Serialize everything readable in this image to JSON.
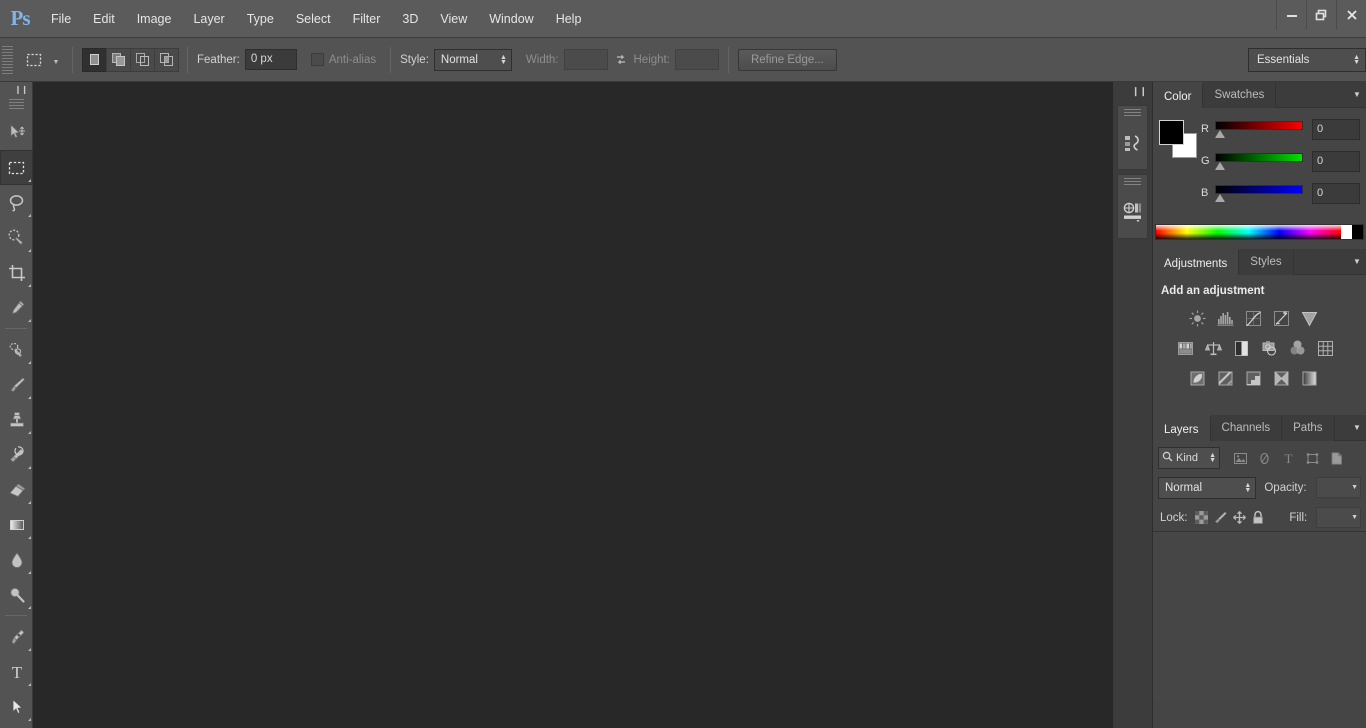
{
  "app": {
    "logo": "Ps",
    "accent_color": "#7fb5e8",
    "menubar_bg": "#5b5b5b",
    "canvas_bg": "#282828",
    "panel_bg": "#454545"
  },
  "menu": {
    "items": [
      {
        "label": "File"
      },
      {
        "label": "Edit"
      },
      {
        "label": "Image"
      },
      {
        "label": "Layer"
      },
      {
        "label": "Type"
      },
      {
        "label": "Select"
      },
      {
        "label": "Filter"
      },
      {
        "label": "3D"
      },
      {
        "label": "View"
      },
      {
        "label": "Window"
      },
      {
        "label": "Help"
      }
    ]
  },
  "window_controls": {
    "minimize": "minimize-icon",
    "restore": "restore-icon",
    "close": "close-icon"
  },
  "options_bar": {
    "tool_icon": "rectangular-marquee-icon",
    "selection_modes": [
      {
        "name": "new-selection",
        "active": true
      },
      {
        "name": "add-to-selection",
        "active": false
      },
      {
        "name": "subtract-from-selection",
        "active": false
      },
      {
        "name": "intersect-with-selection",
        "active": false
      }
    ],
    "feather_label": "Feather:",
    "feather_value": "0 px",
    "antialias_label": "Anti-alias",
    "antialias_checked": false,
    "style_label": "Style:",
    "style_value": "Normal",
    "width_label": "Width:",
    "width_value": "",
    "swap_icon": "swap-width-height-icon",
    "height_label": "Height:",
    "height_value": "",
    "refine_edge_label": "Refine Edge...",
    "workspace": "Essentials"
  },
  "toolbar": {
    "collapse_icon": "collapse-panel-icon",
    "tools": [
      {
        "name": "move-tool",
        "active": false,
        "has_flyout": false
      },
      {
        "name": "rectangular-marquee-tool",
        "active": true,
        "has_flyout": true
      },
      {
        "name": "lasso-tool",
        "active": false,
        "has_flyout": true
      },
      {
        "name": "quick-selection-tool",
        "active": false,
        "has_flyout": true
      },
      {
        "name": "crop-tool",
        "active": false,
        "has_flyout": true
      },
      {
        "name": "eyedropper-tool",
        "active": false,
        "has_flyout": true
      },
      {
        "name": "spot-healing-brush-tool",
        "active": false,
        "has_flyout": true
      },
      {
        "name": "brush-tool",
        "active": false,
        "has_flyout": true
      },
      {
        "name": "clone-stamp-tool",
        "active": false,
        "has_flyout": true
      },
      {
        "name": "history-brush-tool",
        "active": false,
        "has_flyout": true
      },
      {
        "name": "eraser-tool",
        "active": false,
        "has_flyout": true
      },
      {
        "name": "gradient-tool",
        "active": false,
        "has_flyout": true
      },
      {
        "name": "blur-tool",
        "active": false,
        "has_flyout": true
      },
      {
        "name": "dodge-tool",
        "active": false,
        "has_flyout": true
      },
      {
        "name": "pen-tool",
        "active": false,
        "has_flyout": true
      },
      {
        "name": "horizontal-type-tool",
        "active": false,
        "has_flyout": true
      },
      {
        "name": "path-selection-tool",
        "active": false,
        "has_flyout": true
      }
    ]
  },
  "icon_dock": {
    "collapse_icon": "expand-panels-icon",
    "buttons": [
      {
        "name": "history-panel-icon"
      },
      {
        "name": "mini-bridge-panel-icon"
      }
    ]
  },
  "color_panel": {
    "tabs": [
      {
        "label": "Color",
        "active": true
      },
      {
        "label": "Swatches",
        "active": false
      }
    ],
    "menu_icon": "panel-menu-icon",
    "foreground_color": "#000000",
    "background_color": "#ffffff",
    "channels": [
      {
        "letter": "R",
        "value": "0",
        "track": "red"
      },
      {
        "letter": "G",
        "value": "0",
        "track": "green"
      },
      {
        "letter": "B",
        "value": "0",
        "track": "blue"
      }
    ],
    "ramp_white_chip": "#ffffff",
    "ramp_black_chip": "#000000"
  },
  "adjustments_panel": {
    "tabs": [
      {
        "label": "Adjustments",
        "active": true
      },
      {
        "label": "Styles",
        "active": false
      }
    ],
    "menu_icon": "panel-menu-icon",
    "title": "Add an adjustment",
    "rows": [
      [
        {
          "name": "brightness-contrast-icon"
        },
        {
          "name": "levels-icon"
        },
        {
          "name": "curves-icon"
        },
        {
          "name": "exposure-icon"
        },
        {
          "name": "vibrance-icon"
        }
      ],
      [
        {
          "name": "hue-saturation-icon"
        },
        {
          "name": "color-balance-icon"
        },
        {
          "name": "black-and-white-icon"
        },
        {
          "name": "photo-filter-icon"
        },
        {
          "name": "channel-mixer-icon"
        },
        {
          "name": "color-lookup-icon"
        }
      ],
      [
        {
          "name": "invert-icon"
        },
        {
          "name": "posterize-icon"
        },
        {
          "name": "threshold-icon"
        },
        {
          "name": "selective-color-icon"
        },
        {
          "name": "gradient-map-icon"
        }
      ]
    ]
  },
  "layers_panel": {
    "tabs": [
      {
        "label": "Layers",
        "active": true
      },
      {
        "label": "Channels",
        "active": false
      },
      {
        "label": "Paths",
        "active": false
      }
    ],
    "menu_icon": "panel-menu-icon",
    "filter_kind_label": "Kind",
    "filter_search_icon": "search-icon",
    "filter_icons": [
      {
        "name": "filter-pixel-layers-icon"
      },
      {
        "name": "filter-adjustment-layers-icon"
      },
      {
        "name": "filter-type-layers-icon"
      },
      {
        "name": "filter-shape-layers-icon"
      },
      {
        "name": "filter-smart-object-layers-icon"
      }
    ],
    "blend_mode": "Normal",
    "opacity_label": "Opacity:",
    "opacity_value": "",
    "lock_label": "Lock:",
    "lock_icons": [
      {
        "name": "lock-transparent-pixels-icon"
      },
      {
        "name": "lock-image-pixels-icon"
      },
      {
        "name": "lock-position-icon"
      },
      {
        "name": "lock-all-icon"
      }
    ],
    "fill_label": "Fill:",
    "fill_value": "",
    "layers": []
  }
}
